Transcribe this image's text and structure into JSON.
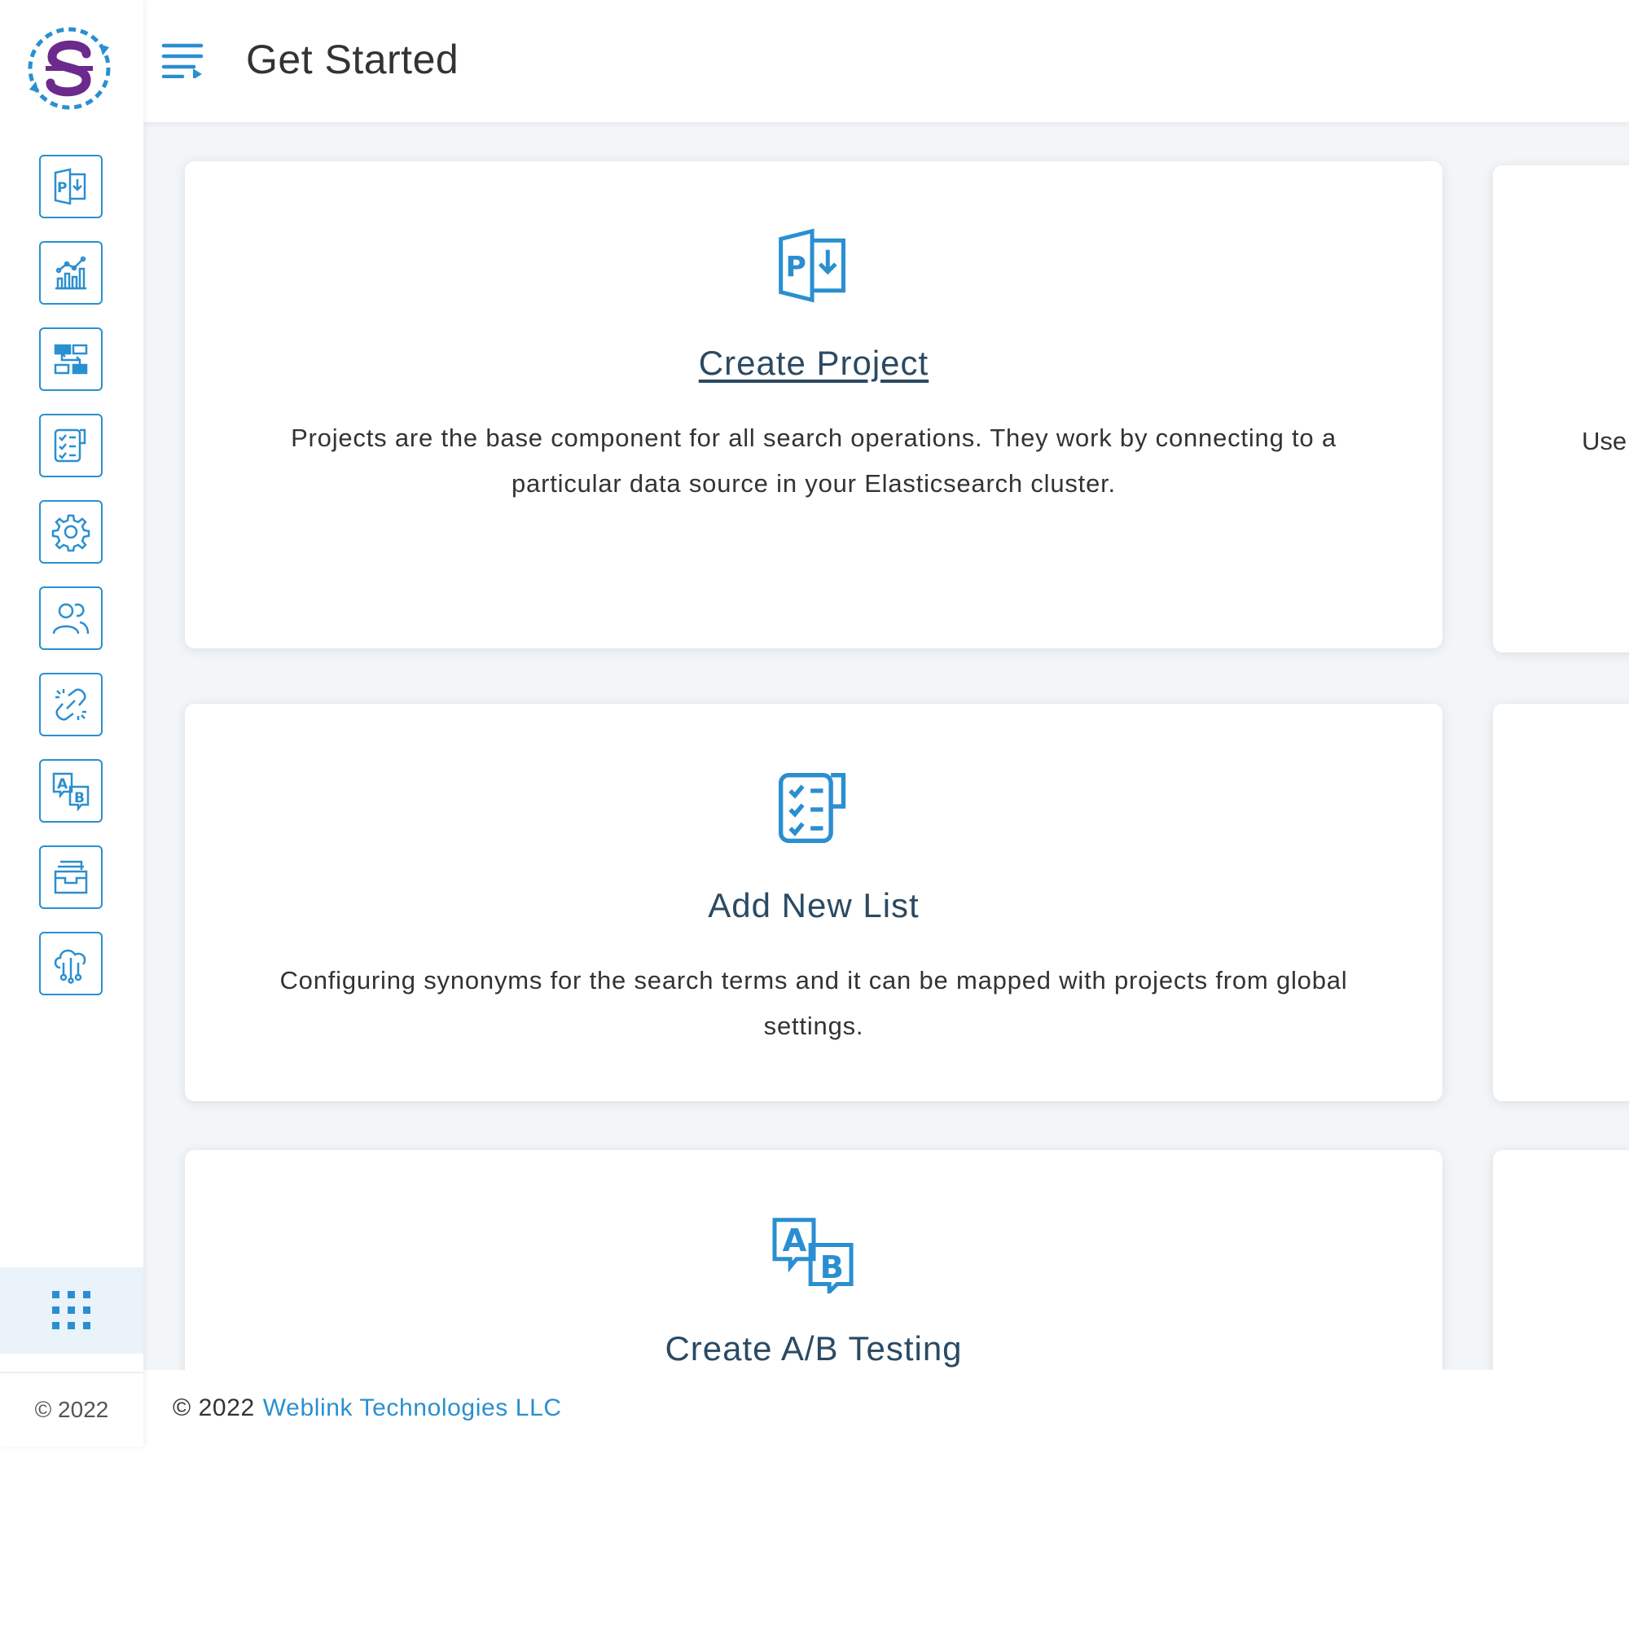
{
  "header": {
    "title": "Get Started"
  },
  "sidebar": {
    "items": [
      {
        "name": "projects",
        "icon": "project-icon"
      },
      {
        "name": "analytics",
        "icon": "analytics-chart-icon"
      },
      {
        "name": "data-mapping",
        "icon": "mapping-icon"
      },
      {
        "name": "lists",
        "icon": "checklist-icon"
      },
      {
        "name": "settings",
        "icon": "gear-icon"
      },
      {
        "name": "users",
        "icon": "users-icon"
      },
      {
        "name": "connections",
        "icon": "link-icon"
      },
      {
        "name": "ab-testing",
        "icon": "ab-test-icon"
      },
      {
        "name": "archive",
        "icon": "archive-tray-icon"
      },
      {
        "name": "cloud",
        "icon": "cloud-network-icon"
      }
    ],
    "copyright": "© 2022"
  },
  "cards": [
    {
      "title": "Create Project",
      "description": "Projects are the base component for all search operations. They work by connecting to a particular data source in your Elasticsearch cluster."
    },
    {
      "title": "Add New List",
      "description": "Configuring synonyms for the search terms and it can be mapped with projects from global settings."
    },
    {
      "title": "Create A/B Testing",
      "description": ""
    }
  ],
  "side_card_peek": "Use",
  "footer": {
    "copyright": "© 2022",
    "company": "Weblink Technologies LLC"
  },
  "colors": {
    "accent": "#2a8fd0",
    "logo_purple": "#6b2a8c",
    "title": "#2b4a63",
    "background": "#f3f6f9"
  }
}
